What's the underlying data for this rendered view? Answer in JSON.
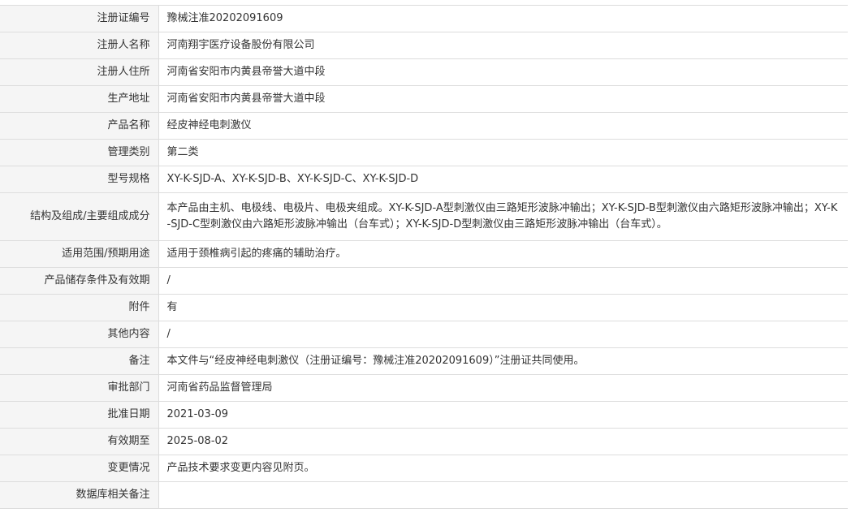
{
  "rows": [
    {
      "label": "注册证编号",
      "value": "豫械注准20202091609"
    },
    {
      "label": "注册人名称",
      "value": "河南翔宇医疗设备股份有限公司"
    },
    {
      "label": "注册人住所",
      "value": "河南省安阳市内黄县帝誉大道中段"
    },
    {
      "label": "生产地址",
      "value": "河南省安阳市内黄县帝誉大道中段"
    },
    {
      "label": "产品名称",
      "value": "经皮神经电刺激仪"
    },
    {
      "label": "管理类别",
      "value": "第二类"
    },
    {
      "label": "型号规格",
      "value": "XY-K-SJD-A、XY-K-SJD-B、XY-K-SJD-C、XY-K-SJD-D"
    },
    {
      "label": "结构及组成/主要组成成分",
      "value": "本产品由主机、电极线、电极片、电极夹组成。XY-K-SJD-A型刺激仪由三路矩形波脉冲输出；XY-K-SJD-B型刺激仪由六路矩形波脉冲输出；XY-K-SJD-C型刺激仪由六路矩形波脉冲输出（台车式）；XY-K-SJD-D型刺激仪由三路矩形波脉冲输出（台车式）。"
    },
    {
      "label": "适用范围/预期用途",
      "value": "适用于颈椎病引起的疼痛的辅助治疗。"
    },
    {
      "label": "产品储存条件及有效期",
      "value": "/"
    },
    {
      "label": "附件",
      "value": "有"
    },
    {
      "label": "其他内容",
      "value": "/"
    },
    {
      "label": "备注",
      "value": "本文件与“经皮神经电刺激仪（注册证编号：豫械注准20202091609）”注册证共同使用。"
    },
    {
      "label": "审批部门",
      "value": "河南省药品监督管理局"
    },
    {
      "label": "批准日期",
      "value": "2021-03-09"
    },
    {
      "label": "有效期至",
      "value": "2025-08-02"
    },
    {
      "label": "变更情况",
      "value": "产品技术要求变更内容见附页。"
    },
    {
      "label": "数据库相关备注",
      "value": ""
    }
  ]
}
